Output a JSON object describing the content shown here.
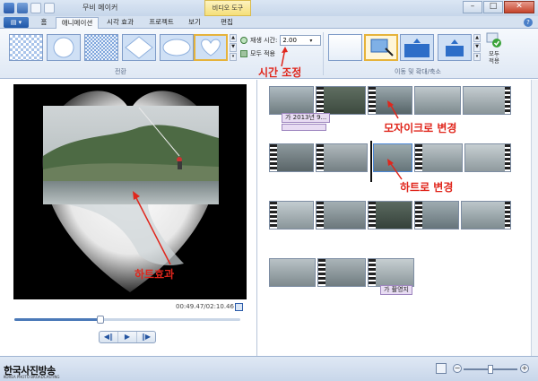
{
  "app": {
    "title": "무비 메이커",
    "context_tab": "비디오 도구"
  },
  "tabs": [
    "홈",
    "애니메이션",
    "시각 효과",
    "프로젝트",
    "보기",
    "편집"
  ],
  "active_tab": "애니메이션",
  "ribbon": {
    "transitions_group_label": "전환",
    "pan_zoom_group_label": "이동 및 확대/축소",
    "duration_label": "재생 시간:",
    "duration_value": "2.00",
    "apply_all_label": "모두 적용",
    "apply_all_button_line1": "모두",
    "apply_all_button_line2": "적용"
  },
  "annotations": {
    "time_adjust": "시간 조정",
    "mosaic_change": "모자이크로 변경",
    "heart_change": "하트로 변경",
    "heart_effect": "하트효과"
  },
  "preview": {
    "time": "00:49.47/02:10.46",
    "progress": 0.38
  },
  "storyboard": {
    "caption_1": "가 2013년 9...",
    "caption_2": "가 촬영지"
  },
  "watermark": {
    "name": "한국사진방송",
    "sub": "KOREA PHOTO BROADCASTING"
  },
  "zoom": {
    "level": 0.5
  },
  "colors": {
    "annotation": "#e0261c",
    "accent": "#4b79b8",
    "selected": "#e6b33b"
  }
}
